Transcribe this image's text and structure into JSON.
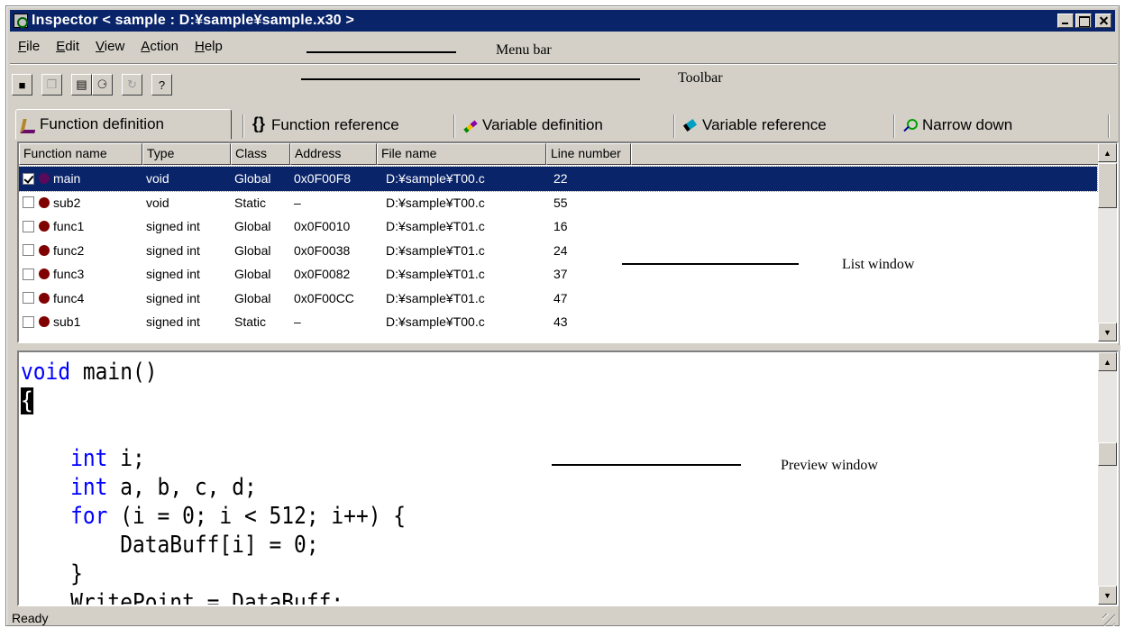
{
  "window": {
    "title": "Inspector < sample : D:¥sample¥sample.x30 >"
  },
  "menu": [
    {
      "label": "File",
      "ul": "F",
      "rest": "ile"
    },
    {
      "label": "Edit",
      "ul": "E",
      "rest": "dit"
    },
    {
      "label": "View",
      "ul": "V",
      "rest": "iew"
    },
    {
      "label": "Action",
      "ul": "A",
      "rest": "ction"
    },
    {
      "label": "Help",
      "ul": "H",
      "rest": "elp"
    }
  ],
  "toolbar": {
    "buttons": [
      {
        "icon": "save-icon",
        "glyph": "■",
        "disabled": false
      },
      {
        "icon": "copy-icon",
        "glyph": "❐",
        "disabled": true
      },
      {
        "icon": "properties-icon",
        "glyph": "▤",
        "disabled": false
      },
      {
        "icon": "find-icon",
        "glyph": "⚆",
        "disabled": false
      },
      {
        "icon": "refresh-icon",
        "glyph": "↻",
        "disabled": true
      },
      {
        "icon": "help-icon",
        "glyph": "?",
        "disabled": false
      }
    ]
  },
  "annotations": {
    "menu_bar": "Menu bar",
    "toolbar": "Toolbar",
    "list_window": "List window",
    "preview_window": "Preview window"
  },
  "tabs": [
    {
      "label": "Function definition",
      "icon": "wrench-icon",
      "active": true
    },
    {
      "label": "Function reference",
      "icon": "braces-icon",
      "active": false
    },
    {
      "label": "Variable definition",
      "icon": "pencil-icon",
      "active": false
    },
    {
      "label": "Variable reference",
      "icon": "eraser-icon",
      "active": false
    },
    {
      "label": "Narrow down",
      "icon": "magnifier-icon",
      "active": false
    }
  ],
  "list": {
    "columns": [
      "Function name",
      "Type",
      "Class",
      "Address",
      "File name",
      "Line number"
    ],
    "rows": [
      {
        "checked": true,
        "name": "main",
        "type": "void",
        "class": "Global",
        "address": "0x0F00F8",
        "file": "D:¥sample¥T00.c",
        "line": "22",
        "selected": true
      },
      {
        "checked": false,
        "name": "sub2",
        "type": "void",
        "class": "Static",
        "address": "–",
        "file": "D:¥sample¥T00.c",
        "line": "55",
        "selected": false
      },
      {
        "checked": false,
        "name": "func1",
        "type": "signed int",
        "class": "Global",
        "address": "0x0F0010",
        "file": "D:¥sample¥T01.c",
        "line": "16",
        "selected": false
      },
      {
        "checked": false,
        "name": "func2",
        "type": "signed int",
        "class": "Global",
        "address": "0x0F0038",
        "file": "D:¥sample¥T01.c",
        "line": "24",
        "selected": false
      },
      {
        "checked": false,
        "name": "func3",
        "type": "signed int",
        "class": "Global",
        "address": "0x0F0082",
        "file": "D:¥sample¥T01.c",
        "line": "37",
        "selected": false
      },
      {
        "checked": false,
        "name": "func4",
        "type": "signed int",
        "class": "Global",
        "address": "0x0F00CC",
        "file": "D:¥sample¥T01.c",
        "line": "47",
        "selected": false
      },
      {
        "checked": false,
        "name": "sub1",
        "type": "signed int",
        "class": "Static",
        "address": "–",
        "file": "D:¥sample¥T00.c",
        "line": "43",
        "selected": false
      }
    ]
  },
  "preview": {
    "lines": [
      [
        {
          "t": "void",
          "k": true
        },
        {
          "t": " main()",
          "k": false
        }
      ],
      [
        {
          "t": "{",
          "c": true
        }
      ],
      [],
      [
        {
          "t": "    ",
          "k": false
        },
        {
          "t": "int",
          "k": true
        },
        {
          "t": " i;",
          "k": false
        }
      ],
      [
        {
          "t": "    ",
          "k": false
        },
        {
          "t": "int",
          "k": true
        },
        {
          "t": " a, b, c, d;",
          "k": false
        }
      ],
      [
        {
          "t": "    ",
          "k": false
        },
        {
          "t": "for",
          "k": true
        },
        {
          "t": " (i = 0; i < 512; i++) {",
          "k": false
        }
      ],
      [
        {
          "t": "        DataBuff[i] = 0;",
          "k": false
        }
      ],
      [
        {
          "t": "    }",
          "k": false
        }
      ],
      [
        {
          "t": "    WritePoint = DataBuff;",
          "k": false
        }
      ]
    ]
  },
  "status": {
    "text": "Ready"
  },
  "colors": {
    "title_bar": "#0a246a",
    "selection": "#0a246a",
    "keyword": "#0000ff",
    "function_dot": "#800000",
    "chrome": "#d4d0c8"
  }
}
